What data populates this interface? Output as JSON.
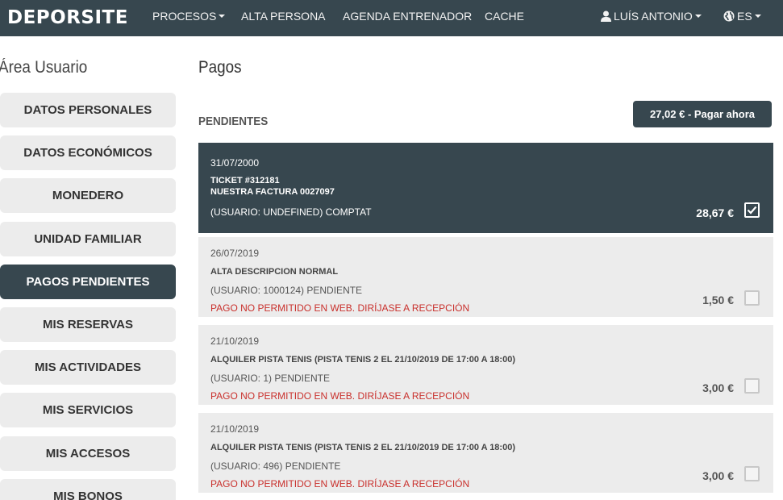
{
  "navbar": {
    "brand": "DEPORSITE",
    "items": [
      {
        "label": "PROCESOS",
        "dropdown": true
      },
      {
        "label": "ALTA PERSONA"
      },
      {
        "label": "AGENDA ENTRENADOR"
      },
      {
        "label": "CACHE"
      }
    ],
    "user": {
      "label": "LUÍS ANTONIO",
      "icon": "user-icon"
    },
    "language": {
      "label": "ES",
      "icon": "globe-icon"
    }
  },
  "sidebar": {
    "title": "Área Usuario",
    "items": [
      {
        "label": "DATOS PERSONALES"
      },
      {
        "label": "DATOS ECONÓMICOS"
      },
      {
        "label": "MONEDERO"
      },
      {
        "label": "UNIDAD FAMILIAR"
      },
      {
        "label": "PAGOS PENDIENTES",
        "active": true
      },
      {
        "label": "MIS RESERVAS"
      },
      {
        "label": "MIS ACTIVIDADES"
      },
      {
        "label": "MIS SERVICIOS"
      },
      {
        "label": "MIS ACCESOS"
      },
      {
        "label": "MIS BONOS"
      }
    ]
  },
  "main": {
    "title": "Pagos",
    "section": "PENDIENTES",
    "pay_button": "27,02 € -  Pagar ahora",
    "payments": [
      {
        "date": "31/07/2000",
        "line1": "TICKET #312181",
        "line2": "NUESTRA FACTURA 0027097",
        "user": "(USUARIO: UNDEFINED) COMPTAT",
        "warning": "",
        "amount": "28,67 €",
        "checked": true
      },
      {
        "date": "26/07/2019",
        "line1": "ALTA DESCRIPCION NORMAL",
        "line2": "",
        "user": "(USUARIO: 1000124) PENDIENTE",
        "warning": "PAGO NO PERMITIDO EN WEB. DIRÍJASE A RECEPCIÓN",
        "amount": "1,50 €",
        "checked": false
      },
      {
        "date": "21/10/2019",
        "line1": "ALQUILER PISTA TENIS (PISTA TENIS 2 EL 21/10/2019 DE 17:00 A 18:00)",
        "line2": "",
        "user": "(USUARIO: 1) PENDIENTE",
        "warning": "PAGO NO PERMITIDO EN WEB. DIRÍJASE A RECEPCIÓN",
        "amount": "3,00 €",
        "checked": false
      },
      {
        "date": "21/10/2019",
        "line1": "ALQUILER PISTA TENIS (PISTA TENIS 2 EL 21/10/2019 DE 17:00 A 18:00)",
        "line2": "",
        "user": "(USUARIO: 496) PENDIENTE",
        "warning": "PAGO NO PERMITIDO EN WEB. DIRÍJASE A RECEPCIÓN",
        "amount": "3,00 €",
        "checked": false
      }
    ]
  },
  "colors": {
    "navbar": "#37474f",
    "button_gray": "#ececec",
    "warning": "#c9302c"
  }
}
